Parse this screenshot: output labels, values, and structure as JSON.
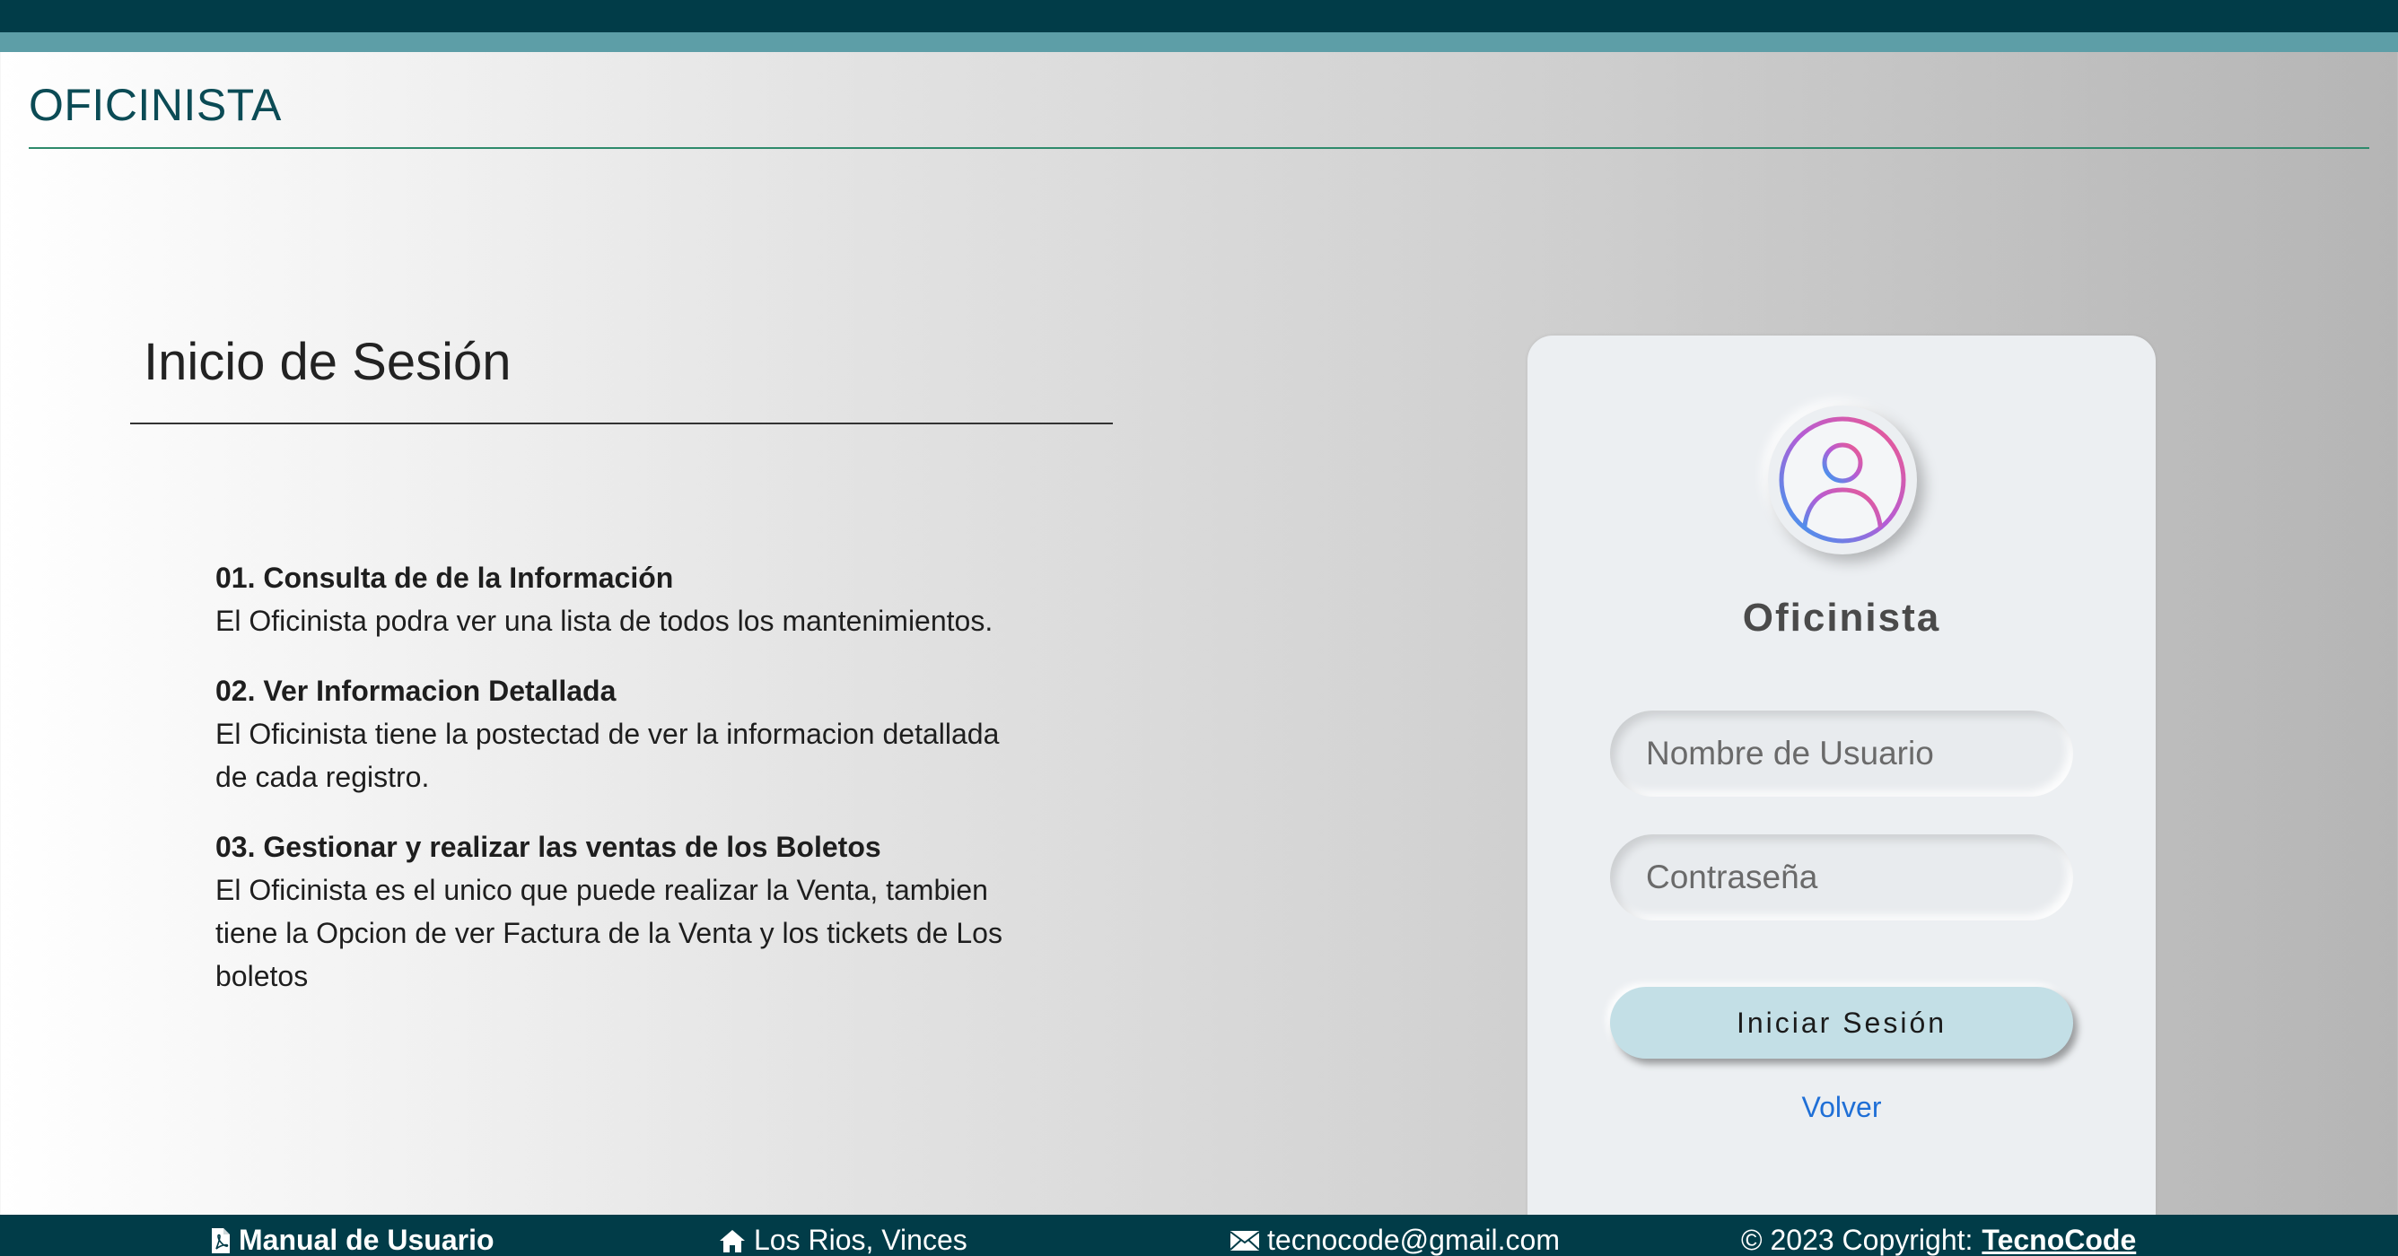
{
  "header": {
    "section_title": "OFICINISTA"
  },
  "info": {
    "heading": "Inicio de Sesión",
    "features": [
      {
        "title": "01. Consulta de de la Información",
        "desc": "El Oficinista podra ver una lista de todos los mantenimientos."
      },
      {
        "title": "02. Ver Informacion Detallada",
        "desc": "El Oficinista tiene la postectad de ver la informacion detallada de cada registro."
      },
      {
        "title": "03. Gestionar y realizar las ventas de los Boletos",
        "desc": "El Oficinista es el unico que puede realizar la Venta, tambien tiene la Opcion de ver Factura de la Venta y los tickets de Los boletos"
      }
    ]
  },
  "login": {
    "avatar_icon": "user-circle-icon",
    "role": "Oficinista",
    "username_placeholder": "Nombre de Usuario",
    "password_placeholder": "Contraseña",
    "submit_label": "Iniciar Sesión",
    "back_label": "Volver"
  },
  "footer": {
    "manual_label": "Manual de Usuario",
    "manual_icon": "pdf-file-icon",
    "address": "Los Rios, Vinces",
    "address_icon": "home-icon",
    "email": "tecnocode@gmail.com",
    "email_icon": "envelope-icon",
    "copyright_prefix": "© 2023 Copyright:",
    "copyright_brand": "TecnoCode"
  },
  "colors": {
    "header_bg": "#013c48",
    "stripe": "#5d9ea7",
    "accent_line": "#2e8a6b",
    "button_bg": "#c3dfe6",
    "link": "#1f6fd6"
  }
}
